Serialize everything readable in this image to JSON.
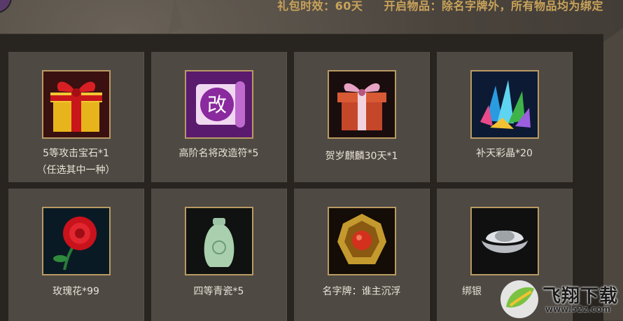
{
  "header": {
    "duration": "礼包时效：60天",
    "contents": "开启物品：除名字牌外，所有物品均为绑定"
  },
  "items": [
    {
      "label": "5等攻击宝石*1",
      "sublabel": "（任选其中一种）",
      "icon": "gift-box-yellow-icon"
    },
    {
      "label": "高阶名将改造符*5",
      "icon": "reform-scroll-icon"
    },
    {
      "label": "贺岁麒麟30天*1",
      "icon": "gift-box-red-icon"
    },
    {
      "label": "补天彩晶*20",
      "icon": "crystal-cluster-icon"
    },
    {
      "label": "玫瑰花*99",
      "icon": "rose-icon"
    },
    {
      "label": "四等青瓷*5",
      "icon": "celadon-vase-icon"
    },
    {
      "label": "名字牌：谁主沉浮",
      "icon": "name-badge-icon"
    },
    {
      "label": "绑银",
      "icon": "silver-ingot-icon"
    }
  ],
  "scroll_glyph": "改",
  "watermark": {
    "brand": "飞翔下载",
    "url": "www.52z.com"
  }
}
